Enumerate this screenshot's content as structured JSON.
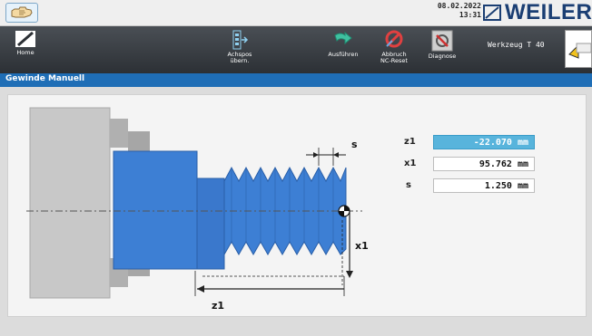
{
  "header": {
    "date": "08.02.2022",
    "time": "13:31",
    "brand": "WEILER"
  },
  "toolbar": {
    "home_label": "Home",
    "accept_axes_label_1": "Achspos",
    "accept_axes_label_2": "übern.",
    "execute_label": "Ausführen",
    "abort_label_1": "Abbruch",
    "abort_label_2": "NC-Reset",
    "diagnosis_label": "Diagnose",
    "tool_label": "Werkzeug  T 40"
  },
  "page": {
    "title": "Gewinde Manuell"
  },
  "params": [
    {
      "label": "z1",
      "value": "-22.070 mm",
      "active": true
    },
    {
      "label": "x1",
      "value": "95.762 mm",
      "active": false
    },
    {
      "label": "s",
      "value": "1.250 mm",
      "active": false
    }
  ],
  "diagram": {
    "label_s": "s",
    "label_x1": "x1",
    "label_z1": "z1",
    "thread_teeth": 9
  },
  "colors": {
    "toolbar": "#2c3035",
    "title_bar": "#1f6eb6",
    "part_blue": "#3d7fd4",
    "active_field": "#58b4dc",
    "brand": "#1a3e73"
  }
}
